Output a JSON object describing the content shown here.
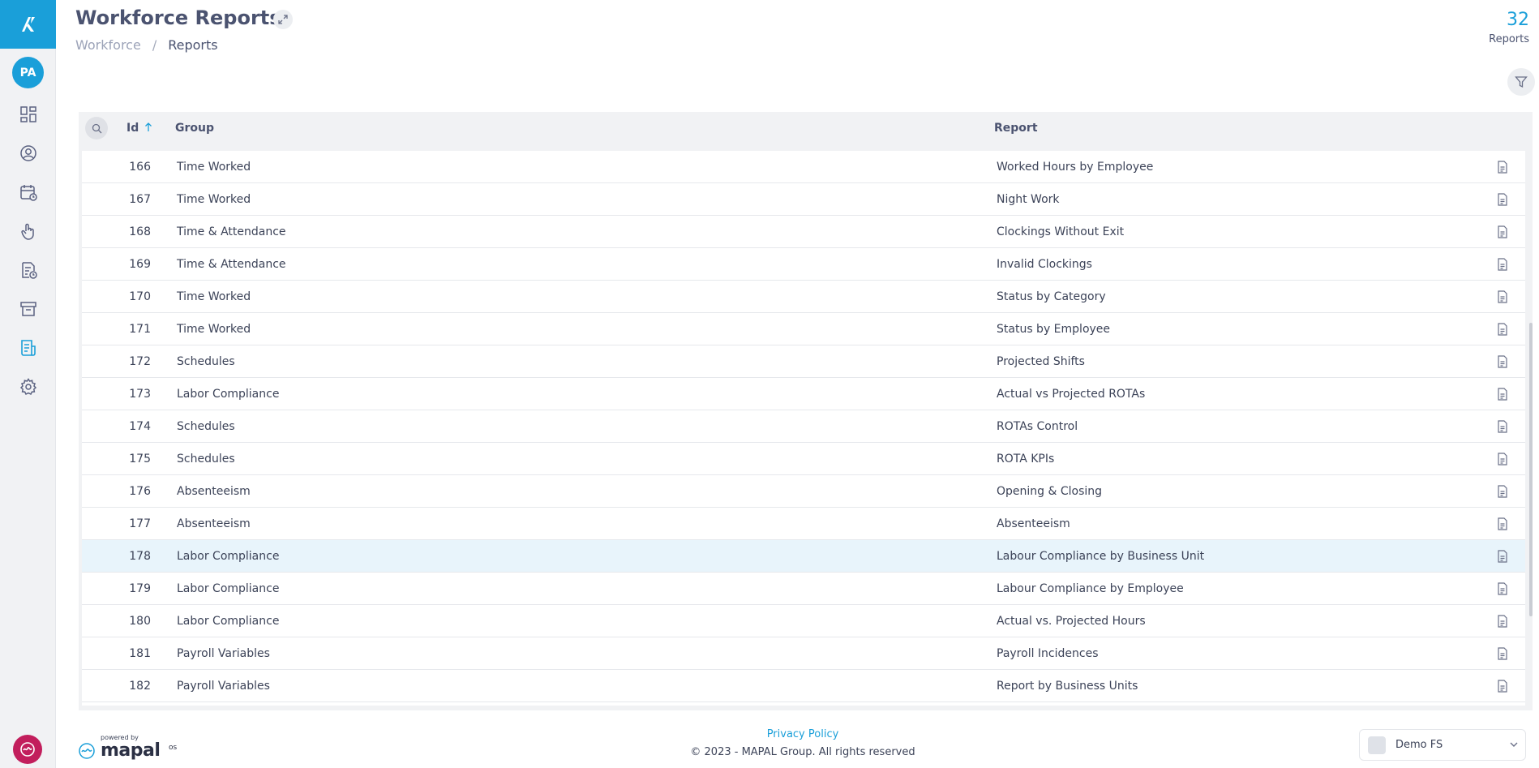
{
  "header": {
    "title": "Workforce Reports",
    "breadcrumb": [
      "Workforce",
      "Reports"
    ],
    "breadcrumb_sep": "/",
    "count": "32",
    "count_label": "Reports"
  },
  "sidebar": {
    "avatar_initials": "PA",
    "icons": [
      "dashboard-icon",
      "user-icon",
      "calendar-clock-icon",
      "touch-icon",
      "document-clock-icon",
      "archive-icon",
      "reports-icon",
      "settings-icon"
    ],
    "active_icon": "reports-icon"
  },
  "table": {
    "columns": {
      "id": "Id",
      "group": "Group",
      "report": "Report"
    },
    "sort": {
      "column": "Id",
      "direction": "ascending"
    },
    "rows": [
      {
        "id": "166",
        "group": "Time Worked",
        "report": "Worked Hours by Employee"
      },
      {
        "id": "167",
        "group": "Time Worked",
        "report": "Night Work"
      },
      {
        "id": "168",
        "group": "Time & Attendance",
        "report": "Clockings Without Exit"
      },
      {
        "id": "169",
        "group": "Time & Attendance",
        "report": "Invalid Clockings"
      },
      {
        "id": "170",
        "group": "Time Worked",
        "report": "Status by Category"
      },
      {
        "id": "171",
        "group": "Time Worked",
        "report": "Status by Employee"
      },
      {
        "id": "172",
        "group": "Schedules",
        "report": "Projected Shifts"
      },
      {
        "id": "173",
        "group": "Labor Compliance",
        "report": "Actual vs Projected ROTAs"
      },
      {
        "id": "174",
        "group": "Schedules",
        "report": "ROTAs Control"
      },
      {
        "id": "175",
        "group": "Schedules",
        "report": "ROTA KPIs"
      },
      {
        "id": "176",
        "group": "Absenteeism",
        "report": "Opening & Closing"
      },
      {
        "id": "177",
        "group": "Absenteeism",
        "report": "Absenteeism"
      },
      {
        "id": "178",
        "group": "Labor Compliance",
        "report": "Labour Compliance by Business Unit",
        "highlighted": true
      },
      {
        "id": "179",
        "group": "Labor Compliance",
        "report": "Labour Compliance by Employee"
      },
      {
        "id": "180",
        "group": "Labor Compliance",
        "report": "Actual vs. Projected Hours"
      },
      {
        "id": "181",
        "group": "Payroll Variables",
        "report": "Payroll Incidences"
      },
      {
        "id": "182",
        "group": "Payroll Variables",
        "report": "Report by Business Units"
      }
    ]
  },
  "footer": {
    "powered_by": "powered by",
    "brand": "mapal",
    "brand_suffix": "os",
    "privacy": "Privacy Policy",
    "copyright": "© 2023 - MAPAL Group. All rights reserved",
    "workspace": "Demo FS"
  },
  "colors": {
    "accent": "#1a9fd9",
    "highlight_row": "#e8f4fb",
    "brand_pink": "#c21e5c"
  }
}
